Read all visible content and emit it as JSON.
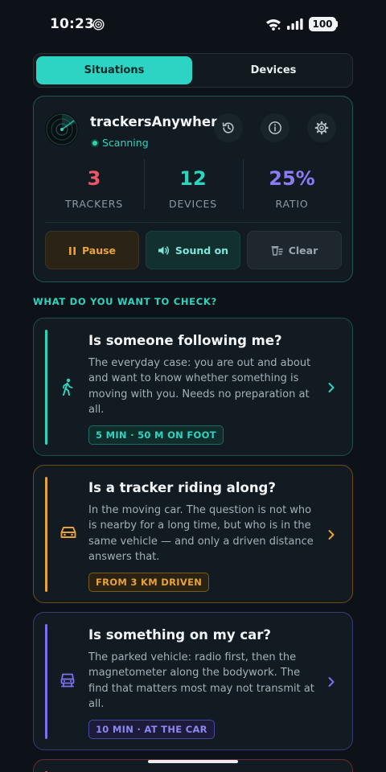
{
  "status_bar": {
    "time": "10:23",
    "battery": "100",
    "icons": [
      "cast-icon",
      "wifi-icon",
      "signal-icon",
      "battery-icon"
    ]
  },
  "tabs": [
    {
      "label": "Situations",
      "active": true
    },
    {
      "label": "Devices",
      "active": false
    }
  ],
  "scanner": {
    "app_name": "trackersAnywhere",
    "status": "Scanning",
    "header_icons": [
      "history-icon",
      "info-icon",
      "settings-icon"
    ],
    "stats": [
      {
        "value": "3",
        "label": "TRACKERS",
        "color": "#f0566a"
      },
      {
        "value": "12",
        "label": "DEVICES",
        "color": "#2dd4bf"
      },
      {
        "value": "25%",
        "label": "RATIO",
        "color": "#8b7cf6"
      }
    ],
    "actions": {
      "pause": "Pause",
      "sound": "Sound on",
      "clear": "Clear"
    }
  },
  "section_title": "WHAT DO YOU WANT TO CHECK?",
  "situations": [
    {
      "title": "Is someone following me?",
      "desc": "The everyday case: you are out and about and want to know whether something is moving with you. Needs no preparation at all.",
      "badge": "5 MIN · 50 M ON FOOT",
      "icon": "walking-icon",
      "accent": "#2dd4bf"
    },
    {
      "title": "Is a tracker riding along?",
      "desc": "In the moving car. The question is not who is nearby for a long time, but who is in the same vehicle — and only a driven distance answers that.",
      "badge": "FROM 3 KM DRIVEN",
      "icon": "car-icon",
      "accent": "#e8a23a"
    },
    {
      "title": "Is something on my car?",
      "desc": "The parked vehicle: radio first, then the magnetometer along the bodywork. The find that matters most may not transmit at all.",
      "badge": "10 MIN · AT THE CAR",
      "icon": "car-underside-icon",
      "accent": "#7c6ff0"
    }
  ],
  "colors": {
    "background": "#0c1217",
    "accent_teal": "#2dd4bf",
    "accent_amber": "#e8a23a",
    "accent_violet": "#7c6ff0",
    "accent_red": "#f0566a"
  }
}
